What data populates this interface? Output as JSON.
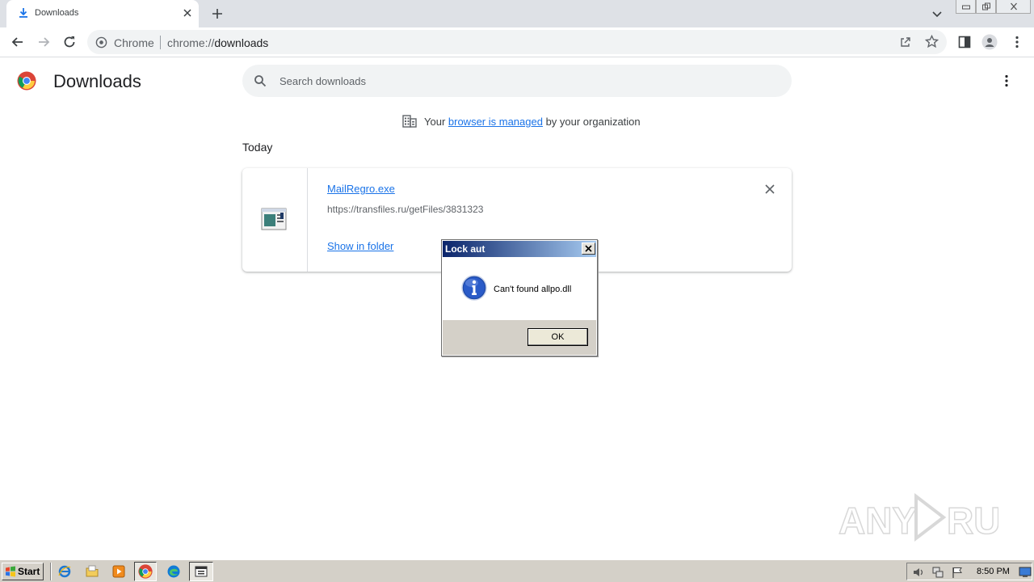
{
  "tab": {
    "title": "Downloads"
  },
  "omnibox": {
    "site": "Chrome",
    "url_scheme": "chrome://",
    "url_path": "downloads"
  },
  "page": {
    "title": "Downloads",
    "search": {
      "placeholder": "Search downloads",
      "value": ""
    },
    "managed": {
      "prefix": "Your ",
      "link": "browser is managed",
      "suffix": " by your organization"
    },
    "section": "Today",
    "downloads": [
      {
        "name": "MailRegro.exe",
        "url": "https://transfiles.ru/getFiles/3831323",
        "action": "Show in folder"
      }
    ]
  },
  "dialog": {
    "title": "Lock aut",
    "message": "Can't found allpo.dll",
    "ok_label": "OK"
  },
  "taskbar": {
    "start_label": "Start",
    "clock": "8:50 PM"
  },
  "watermark": "ANY RUN",
  "colors": {
    "link": "#1a73e8",
    "tab_strip": "#dee1e6",
    "dialog_title_start": "#0a246a",
    "dialog_title_end": "#a6caf0",
    "taskbar": "#d4d0c8"
  },
  "icons": [
    "download-icon",
    "close-icon",
    "plus-icon",
    "chevron-down-icon",
    "minimize-icon",
    "restore-icon",
    "back-icon",
    "forward-icon",
    "reload-icon",
    "chrome-icon",
    "share-icon",
    "star-icon",
    "side-panel-icon",
    "profile-icon",
    "more-icon",
    "search-icon",
    "building-icon",
    "file-icon",
    "info-icon"
  ]
}
